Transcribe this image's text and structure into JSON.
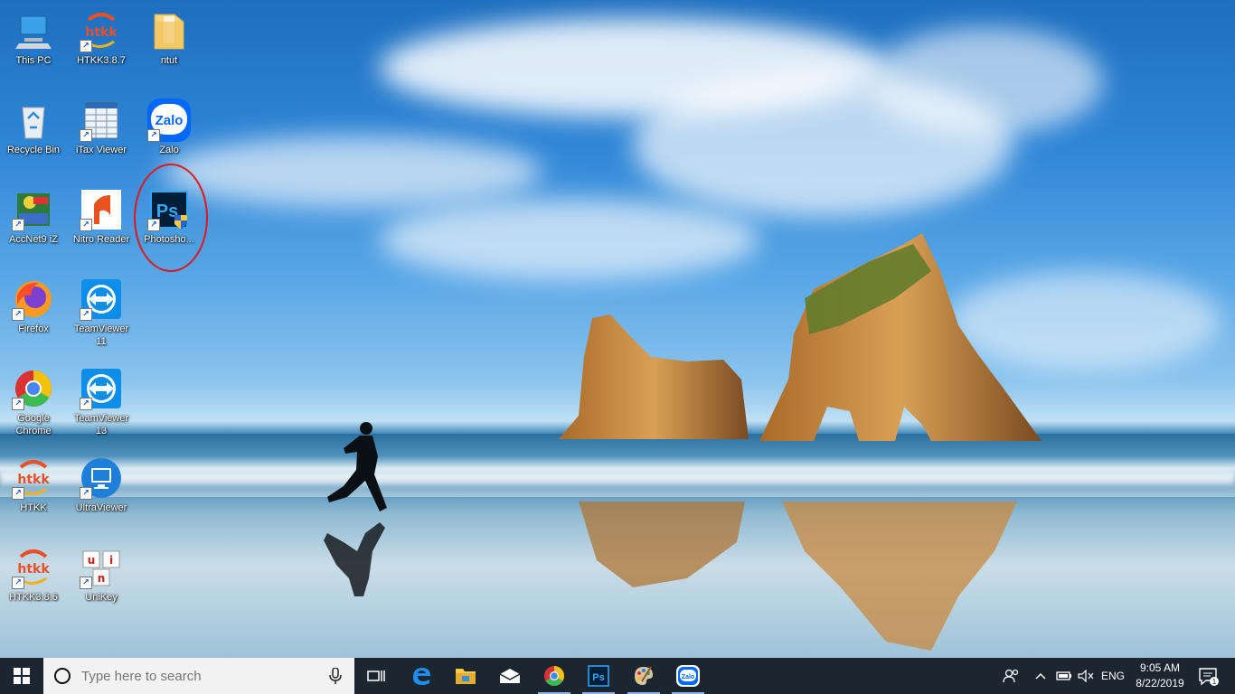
{
  "desktop": {
    "icons": [
      {
        "label": "This PC"
      },
      {
        "label": "HTKK3.8.7"
      },
      {
        "label": "ntut"
      },
      {
        "label": "Recycle Bin"
      },
      {
        "label": "iTax Viewer"
      },
      {
        "label": "Zalo"
      },
      {
        "label": "AccNet9 iZ"
      },
      {
        "label": "Nitro Reader"
      },
      {
        "label": "Photosho..."
      },
      {
        "label": "Firefox"
      },
      {
        "label": "TeamViewer 11"
      },
      {
        "label": "Google Chrome"
      },
      {
        "label": "TeamViewer 13"
      },
      {
        "label": "HTKK"
      },
      {
        "label": "UltraViewer"
      },
      {
        "label": "HTKK3.8.6"
      },
      {
        "label": "UniKey"
      }
    ],
    "glyphs": {
      "htkk": "htkk",
      "zalo": "Zalo",
      "ps": "Ps",
      "unikey_u": "u",
      "unikey_i": "i",
      "unikey_n": "n",
      "shortcut": "↗"
    }
  },
  "taskbar": {
    "search_placeholder": "Type here to search",
    "tray": {
      "language": "ENG",
      "time": "9:05 AM",
      "date": "8/22/2019",
      "notification_count": "1"
    },
    "apps": [
      "task-view",
      "edge",
      "file-explorer",
      "mail",
      "chrome",
      "photoshop",
      "paint",
      "zalo"
    ]
  },
  "colors": {
    "taskbar": "#1c2631",
    "highlight_ring": "#e0161a",
    "photoshop": "#001e36"
  }
}
